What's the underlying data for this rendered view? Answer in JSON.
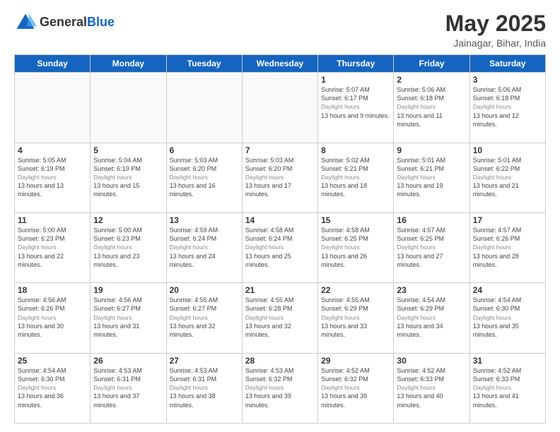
{
  "header": {
    "logo_general": "General",
    "logo_blue": "Blue",
    "month_year": "May 2025",
    "location": "Jainagar, Bihar, India"
  },
  "days_of_week": [
    "Sunday",
    "Monday",
    "Tuesday",
    "Wednesday",
    "Thursday",
    "Friday",
    "Saturday"
  ],
  "weeks": [
    [
      {
        "day": "",
        "info": ""
      },
      {
        "day": "",
        "info": ""
      },
      {
        "day": "",
        "info": ""
      },
      {
        "day": "",
        "info": ""
      },
      {
        "day": "1",
        "sunrise": "5:07 AM",
        "sunset": "6:17 PM",
        "daylight": "13 hours and 9 minutes."
      },
      {
        "day": "2",
        "sunrise": "5:06 AM",
        "sunset": "6:18 PM",
        "daylight": "13 hours and 11 minutes."
      },
      {
        "day": "3",
        "sunrise": "5:06 AM",
        "sunset": "6:18 PM",
        "daylight": "13 hours and 12 minutes."
      }
    ],
    [
      {
        "day": "4",
        "sunrise": "5:05 AM",
        "sunset": "6:19 PM",
        "daylight": "13 hours and 13 minutes."
      },
      {
        "day": "5",
        "sunrise": "5:04 AM",
        "sunset": "6:19 PM",
        "daylight": "13 hours and 15 minutes."
      },
      {
        "day": "6",
        "sunrise": "5:03 AM",
        "sunset": "6:20 PM",
        "daylight": "13 hours and 16 minutes."
      },
      {
        "day": "7",
        "sunrise": "5:03 AM",
        "sunset": "6:20 PM",
        "daylight": "13 hours and 17 minutes."
      },
      {
        "day": "8",
        "sunrise": "5:02 AM",
        "sunset": "6:21 PM",
        "daylight": "13 hours and 18 minutes."
      },
      {
        "day": "9",
        "sunrise": "5:01 AM",
        "sunset": "6:21 PM",
        "daylight": "13 hours and 19 minutes."
      },
      {
        "day": "10",
        "sunrise": "5:01 AM",
        "sunset": "6:22 PM",
        "daylight": "13 hours and 21 minutes."
      }
    ],
    [
      {
        "day": "11",
        "sunrise": "5:00 AM",
        "sunset": "6:23 PM",
        "daylight": "13 hours and 22 minutes."
      },
      {
        "day": "12",
        "sunrise": "5:00 AM",
        "sunset": "6:23 PM",
        "daylight": "13 hours and 23 minutes."
      },
      {
        "day": "13",
        "sunrise": "4:59 AM",
        "sunset": "6:24 PM",
        "daylight": "13 hours and 24 minutes."
      },
      {
        "day": "14",
        "sunrise": "4:58 AM",
        "sunset": "6:24 PM",
        "daylight": "13 hours and 25 minutes."
      },
      {
        "day": "15",
        "sunrise": "4:58 AM",
        "sunset": "6:25 PM",
        "daylight": "13 hours and 26 minutes."
      },
      {
        "day": "16",
        "sunrise": "4:57 AM",
        "sunset": "6:25 PM",
        "daylight": "13 hours and 27 minutes."
      },
      {
        "day": "17",
        "sunrise": "4:57 AM",
        "sunset": "6:26 PM",
        "daylight": "13 hours and 28 minutes."
      }
    ],
    [
      {
        "day": "18",
        "sunrise": "4:56 AM",
        "sunset": "6:26 PM",
        "daylight": "13 hours and 30 minutes."
      },
      {
        "day": "19",
        "sunrise": "4:56 AM",
        "sunset": "6:27 PM",
        "daylight": "13 hours and 31 minutes."
      },
      {
        "day": "20",
        "sunrise": "4:55 AM",
        "sunset": "6:27 PM",
        "daylight": "13 hours and 32 minutes."
      },
      {
        "day": "21",
        "sunrise": "4:55 AM",
        "sunset": "6:28 PM",
        "daylight": "13 hours and 32 minutes."
      },
      {
        "day": "22",
        "sunrise": "4:55 AM",
        "sunset": "6:29 PM",
        "daylight": "13 hours and 33 minutes."
      },
      {
        "day": "23",
        "sunrise": "4:54 AM",
        "sunset": "6:29 PM",
        "daylight": "13 hours and 34 minutes."
      },
      {
        "day": "24",
        "sunrise": "4:54 AM",
        "sunset": "6:30 PM",
        "daylight": "13 hours and 35 minutes."
      }
    ],
    [
      {
        "day": "25",
        "sunrise": "4:54 AM",
        "sunset": "6:30 PM",
        "daylight": "13 hours and 36 minutes."
      },
      {
        "day": "26",
        "sunrise": "4:53 AM",
        "sunset": "6:31 PM",
        "daylight": "13 hours and 37 minutes."
      },
      {
        "day": "27",
        "sunrise": "4:53 AM",
        "sunset": "6:31 PM",
        "daylight": "13 hours and 38 minutes."
      },
      {
        "day": "28",
        "sunrise": "4:53 AM",
        "sunset": "6:32 PM",
        "daylight": "13 hours and 39 minutes."
      },
      {
        "day": "29",
        "sunrise": "4:52 AM",
        "sunset": "6:32 PM",
        "daylight": "13 hours and 39 minutes."
      },
      {
        "day": "30",
        "sunrise": "4:52 AM",
        "sunset": "6:33 PM",
        "daylight": "13 hours and 40 minutes."
      },
      {
        "day": "31",
        "sunrise": "4:52 AM",
        "sunset": "6:33 PM",
        "daylight": "13 hours and 41 minutes."
      }
    ]
  ],
  "labels": {
    "sunrise": "Sunrise:",
    "sunset": "Sunset:",
    "daylight": "Daylight hours"
  }
}
